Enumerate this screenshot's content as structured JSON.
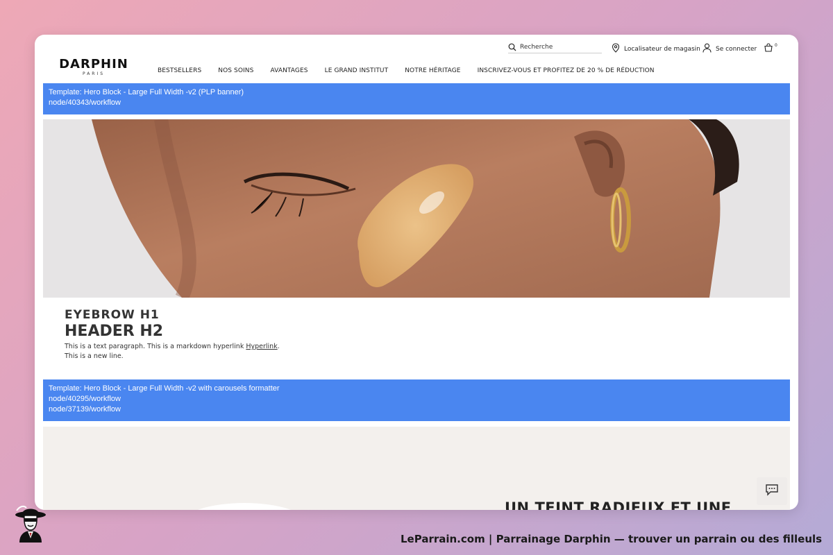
{
  "header": {
    "brand": "DARPHIN",
    "brand_sub": "PARIS",
    "search_placeholder": "Recherche",
    "store_locator": "Localisateur de magasin",
    "login": "Se connecter",
    "cart_count": "0"
  },
  "nav": {
    "items": [
      "BESTSELLERS",
      "NOS SOINS",
      "AVANTAGES",
      "LE GRAND INSTITUT",
      "NOTRE HÉRITAGE",
      "INSCRIVEZ-VOUS ET PROFITEZ DE 20 % DE RÉDUCTION"
    ]
  },
  "banner1": {
    "line1": "Template: Hero Block - Large Full Width -v2 (PLP banner)",
    "line2": "node/40343/workflow"
  },
  "content": {
    "eyebrow": "EYEBROW H1",
    "header": "HEADER H2",
    "para_text": "This is a text paragraph. This is a markdown hyperlink ",
    "link": "Hyperlink",
    "para_end": ".",
    "line2": "This is a new line."
  },
  "banner2": {
    "line1": "Template: Hero Block - Large Full Width -v2 with carousels formatter",
    "line2": "node/40295/workflow",
    "line3": "node/37139/workflow"
  },
  "hero2": {
    "title": "UN TEINT RADIEUX ET UNE"
  },
  "footer": {
    "text": "LeParrain.com | Parrainage Darphin — trouver un parrain ou des filleuls"
  },
  "colors": {
    "banner": "#4a86f0",
    "hero_bg": "#e6e4e5",
    "skin": "#b07658"
  }
}
